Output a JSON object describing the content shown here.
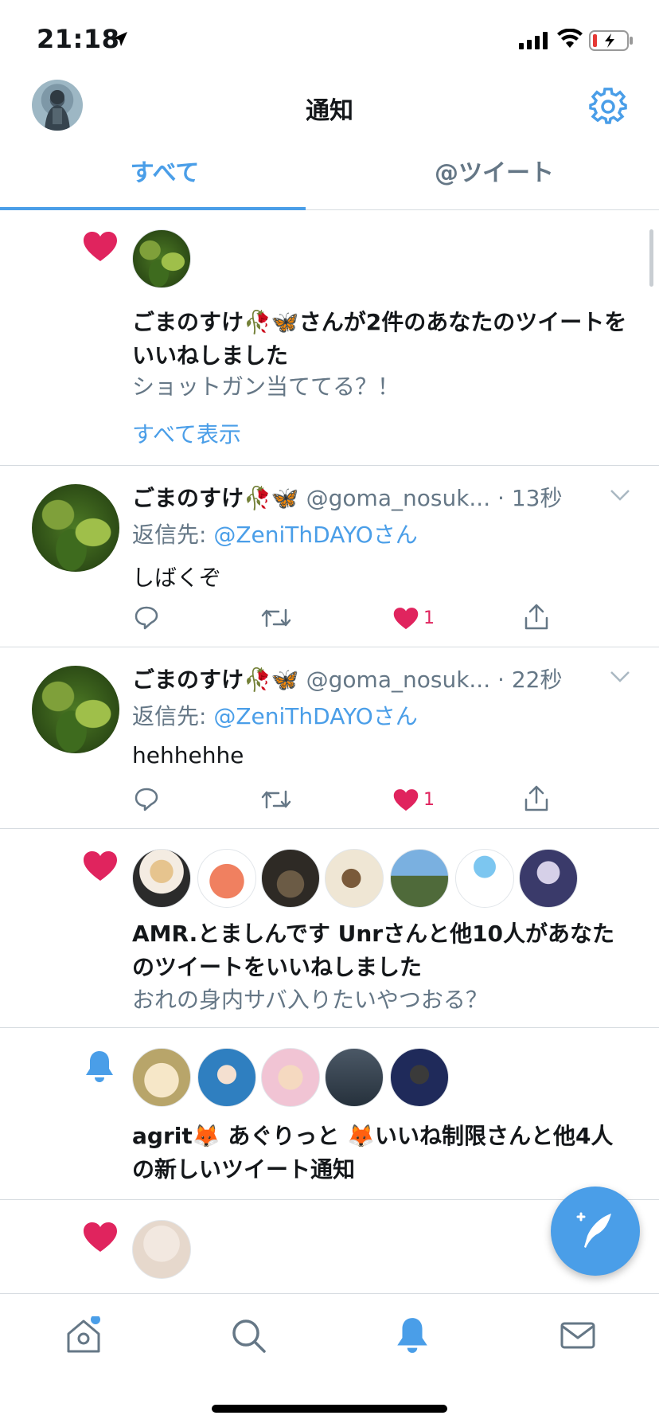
{
  "status_bar": {
    "time": "21:18"
  },
  "header": {
    "title": "通知"
  },
  "tabs": [
    {
      "label": "すべて",
      "active": true
    },
    {
      "label": "@ツイート",
      "active": false
    }
  ],
  "notifications": [
    {
      "type": "like",
      "text": "ごまのすけ🥀🦋さんが2件のあなたのツイートをいいねしました",
      "preview": "ショットガン当ててる？！",
      "show_all": "すべて表示"
    },
    {
      "type": "tweet",
      "name": "ごまのすけ🥀🦋",
      "handle": "@goma_nosuk...",
      "time": "· 13秒",
      "reply_prefix": "返信先: ",
      "reply_to": "@ZeniThDAYOさん",
      "body": "しばくぞ",
      "like_count": "1"
    },
    {
      "type": "tweet",
      "name": "ごまのすけ🥀🦋",
      "handle": "@goma_nosuk...",
      "time": "· 22秒",
      "reply_prefix": "返信先: ",
      "reply_to": "@ZeniThDAYOさん",
      "body": "hehhehhe",
      "like_count": "1"
    },
    {
      "type": "like",
      "text": "AMR.とましんです Unrさんと他10人があなたのツイートをいいねしました",
      "preview": "おれの身内サバ入りたいやつおる？"
    },
    {
      "type": "tweet_notification",
      "text": "agrit🦊 あぐりっと 🦊いいね制限さんと他4人の新しいツイート通知"
    },
    {
      "type": "like"
    }
  ],
  "colors": {
    "accent": "#4a9ee8",
    "like": "#e0245e",
    "text": "#14171a",
    "secondary": "#657786",
    "divider": "#d6dbe0"
  },
  "icons": [
    "location-arrow-icon",
    "signal-icon",
    "wifi-icon",
    "battery-icon",
    "gear-icon",
    "heart-icon",
    "bell-icon",
    "reply-icon",
    "retweet-icon",
    "share-icon",
    "chevron-down-icon",
    "compose-icon",
    "home-icon",
    "search-icon",
    "notifications-icon",
    "messages-icon"
  ]
}
